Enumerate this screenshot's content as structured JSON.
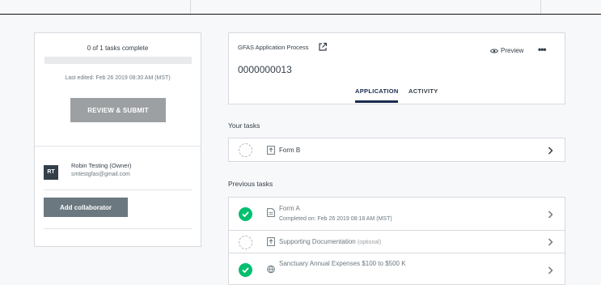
{
  "sidebar": {
    "progress_text": "0 of 1 tasks complete",
    "progress_fraction": 0,
    "last_edited": "Last edited: Feb 26 2019 08:30 AM (MST)",
    "review_button": "REVIEW & SUBMIT",
    "collaborator": {
      "initials": "RT",
      "name": "Robin Testing (Owner)",
      "email": "smtestgfas@gmail.com"
    },
    "add_collaborator_button": "Add collaborator"
  },
  "header": {
    "process_name": "GFAS Application Process",
    "preview_label": "Preview",
    "more_label": "•••",
    "application_id": "0000000013",
    "tabs": [
      "APPLICATION",
      "ACTIVITY"
    ]
  },
  "your_tasks": {
    "label": "Your tasks",
    "items": [
      {
        "title": "Form B",
        "status": "incomplete",
        "icon": "upload-doc-icon"
      }
    ]
  },
  "previous_tasks": {
    "label": "Previous tasks",
    "items": [
      {
        "title": "Form A",
        "subtitle": "Completed on: Feb 26 2019 08:18 AM (MST)",
        "status": "complete",
        "icon": "document-icon"
      },
      {
        "title": "Supporting Documentation",
        "tag": "(optional)",
        "status": "incomplete",
        "icon": "upload-doc-icon"
      },
      {
        "title": "Sanctuary Annual Expenses $100 to $500 K",
        "status": "complete",
        "icon": "globe-icon"
      }
    ]
  },
  "colors": {
    "accent_green": "#00bf6f",
    "tab_active": "#1a2b4e"
  }
}
